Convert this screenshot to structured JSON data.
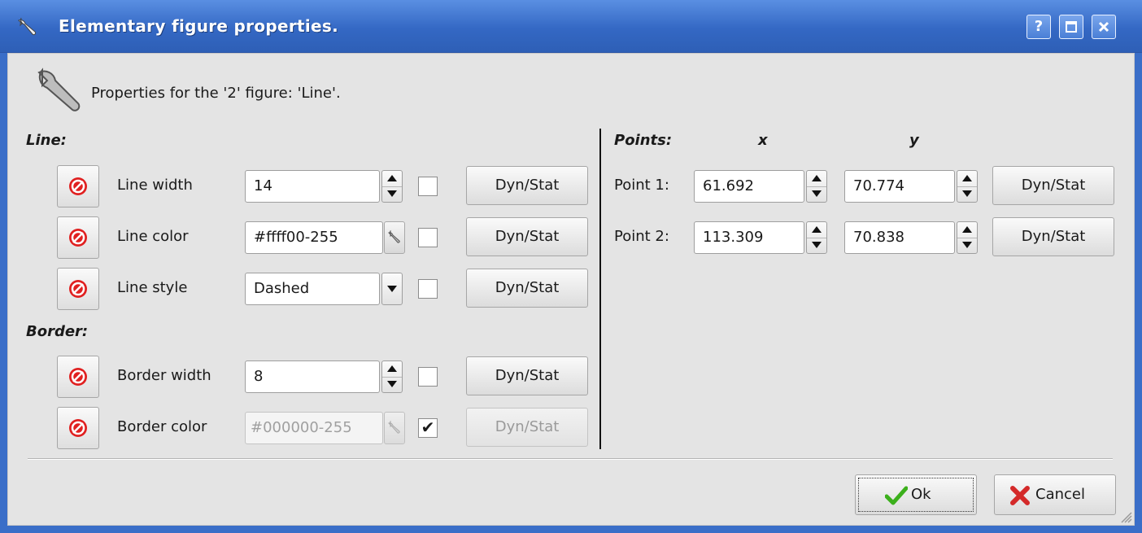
{
  "window": {
    "title": "Elementary figure properties.",
    "controls": {
      "help": "?",
      "maximize": "☐",
      "close": "✕"
    }
  },
  "header": {
    "text": "Properties for the '2' figure: 'Line'."
  },
  "line_section": {
    "label": "Line:",
    "rows": [
      {
        "label": "Line width",
        "value": "14",
        "checked": false,
        "dyn": "Dyn/Stat"
      },
      {
        "label": "Line color",
        "value": "#ffff00-255",
        "checked": false,
        "dyn": "Dyn/Stat"
      },
      {
        "label": "Line style",
        "value": "Dashed",
        "checked": false,
        "dyn": "Dyn/Stat"
      }
    ]
  },
  "border_section": {
    "label": "Border:",
    "rows": [
      {
        "label": "Border width",
        "value": "8",
        "checked": false,
        "dyn": "Dyn/Stat"
      },
      {
        "label": "Border color",
        "value": "#000000-255",
        "checked": true,
        "check_mark": "✔",
        "dyn": "Dyn/Stat"
      }
    ]
  },
  "points_section": {
    "label": "Points:",
    "x_header": "x",
    "y_header": "y",
    "rows": [
      {
        "label": "Point 1:",
        "x": "61.692",
        "y": "70.774",
        "dyn": "Dyn/Stat"
      },
      {
        "label": "Point 2:",
        "x": "113.309",
        "y": "70.838",
        "dyn": "Dyn/Stat"
      }
    ]
  },
  "footer": {
    "ok": "Ok",
    "cancel": "Cancel"
  },
  "colors": {
    "titlebar": "#3468c4",
    "dialog_bg": "#e4e4e4",
    "no_icon": "#e02020",
    "ok_check": "#3cb01c",
    "cancel_x": "#d42a2a"
  }
}
